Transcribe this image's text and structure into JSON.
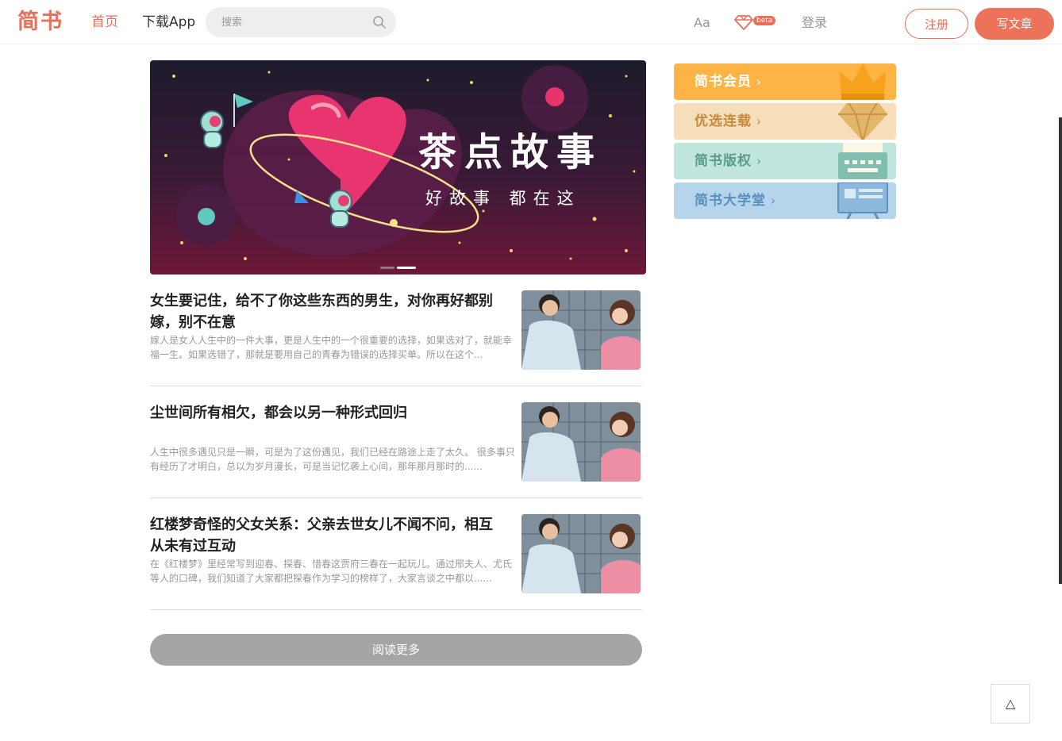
{
  "header": {
    "logo": "简书",
    "nav_home": "首页",
    "nav_app": "下载App",
    "search_placeholder": "搜索",
    "aa": "Aa",
    "beta": "beta",
    "login": "登录",
    "register": "注册",
    "write": "写文章"
  },
  "banner": {
    "title": "茶点故事",
    "subtitle": "好故事 都在这"
  },
  "articles": [
    {
      "title": "女生要记住，给不了你这些东西的男生，对你再好都别嫁，别不在意",
      "abstract": "嫁人是女人人生中的一件大事，更是人生中的一个很重要的选择，如果选对了，就能幸福一生。如果选错了，那就是要用自己的青春为错误的选择买单。所以在这个..."
    },
    {
      "title": "尘世间所有相欠，都会以另一种形式回归",
      "abstract": "人生中很多遇见只是一瞬，可是为了这份遇见，我们已经在路途上走了太久。 很多事只有经历了才明白，总以为岁月漫长，可是当记忆袭上心间，那年那月那时的......"
    },
    {
      "title": "红楼梦奇怪的父女关系：父亲去世女儿不闻不问，相互从未有过互动",
      "abstract": "在《红楼梦》里经常写到迎春、探春、惜春这贾府三春在一起玩儿。通过邢夫人、尤氏等人的口碑，我们知道了大家都把探春作为学习的榜样了，大家言谈之中都以......"
    }
  ],
  "read_more": "阅读更多",
  "boards": [
    {
      "label": "简书会员",
      "color": "#fdb444",
      "icon": "crown-icon"
    },
    {
      "label": "优选连载",
      "color": "#f5deb9",
      "icon": "diamond-icon"
    },
    {
      "label": "简书版权",
      "color": "#bfe5dc",
      "icon": "typewriter-icon"
    },
    {
      "label": "简书大学堂",
      "color": "#b7d5ea",
      "icon": "presentation-board-icon"
    }
  ],
  "back_to_top": "△",
  "colors": {
    "accent": "#ea6f5a",
    "write_button": "#ec7259",
    "read_more": "#a5a5a5"
  }
}
